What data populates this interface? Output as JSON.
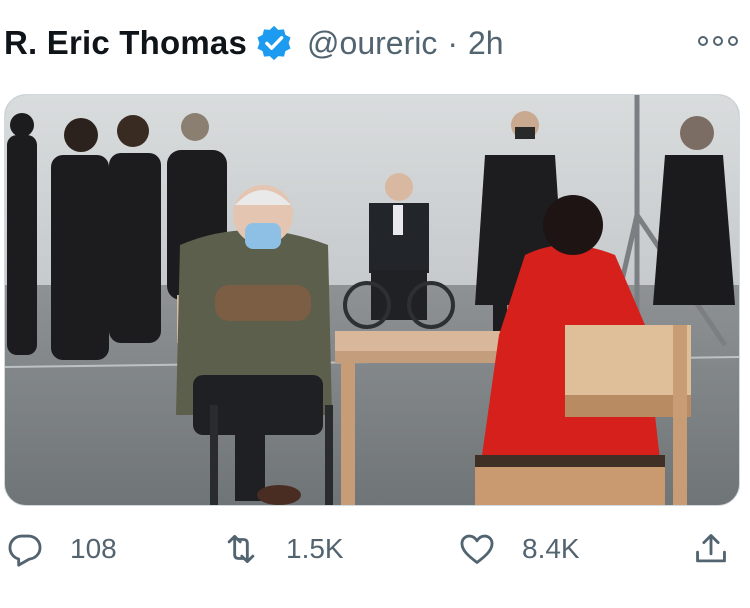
{
  "tweet": {
    "author_name": "R. Eric Thomas",
    "handle": "@oureric",
    "separator": "·",
    "time": "2h",
    "verified": true
  },
  "actions": {
    "replies": "108",
    "retweets": "1.5K",
    "likes": "8.4K"
  },
  "icons": {
    "verified": "verified-badge-icon",
    "more": "more-options-icon",
    "reply": "reply-icon",
    "retweet": "retweet-icon",
    "like": "heart-icon",
    "share": "share-icon"
  },
  "colors": {
    "verified_blue": "#1d9bf0",
    "muted_text": "#536471",
    "primary_text": "#0f1419"
  }
}
